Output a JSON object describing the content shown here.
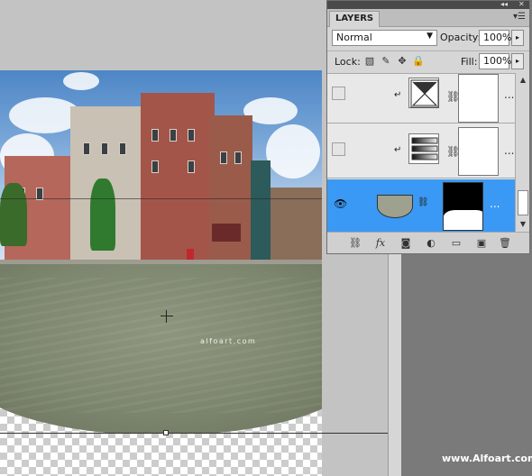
{
  "panel": {
    "tab_label": "LAYERS",
    "menu_icon": "panel-menu-icon",
    "collapse_glyph": "◂◂",
    "close_glyph": "✕"
  },
  "blend_mode": {
    "value": "Normal",
    "arrow": "▼"
  },
  "opacity": {
    "label": "Opacity:",
    "value": "100%"
  },
  "lock": {
    "label": "Lock:"
  },
  "fill": {
    "label": "Fill:",
    "value": "100%"
  },
  "layers": [
    {
      "visible": false,
      "clipped": true,
      "type": "adjustment-curves",
      "selected": false,
      "more": "..."
    },
    {
      "visible": false,
      "clipped": true,
      "type": "adjustment-gradient-map",
      "selected": false,
      "more": "..."
    },
    {
      "visible": true,
      "clipped": false,
      "type": "image-with-mask",
      "selected": true,
      "more": "..."
    }
  ],
  "canvas": {
    "watermark": "alfoart.com"
  },
  "footer": {
    "credit": "www.Alfoart.com"
  },
  "colors": {
    "selection": "#3a99f4",
    "panel_bg": "#d6d6d6",
    "canvas_bg": "#c3c3c3"
  }
}
